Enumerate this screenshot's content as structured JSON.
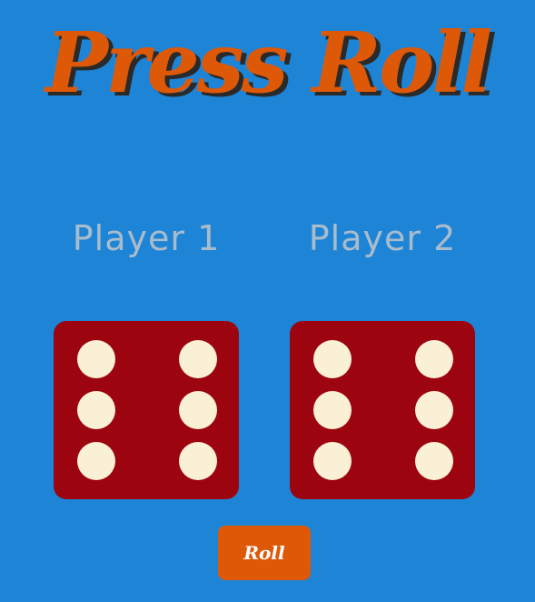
{
  "title": "Press Roll",
  "players": [
    {
      "label": "Player 1",
      "die_value": 6
    },
    {
      "label": "Player 2",
      "die_value": 6
    }
  ],
  "roll_button_label": "Roll",
  "colors": {
    "background": "#1e84d6",
    "title": "#de5907",
    "title_shadow": "#2a2a2a",
    "player_label": "#a9bccc",
    "die": "#9c050f",
    "pip": "#faf0d6",
    "button": "#de5907",
    "button_text": "#ffffff"
  }
}
